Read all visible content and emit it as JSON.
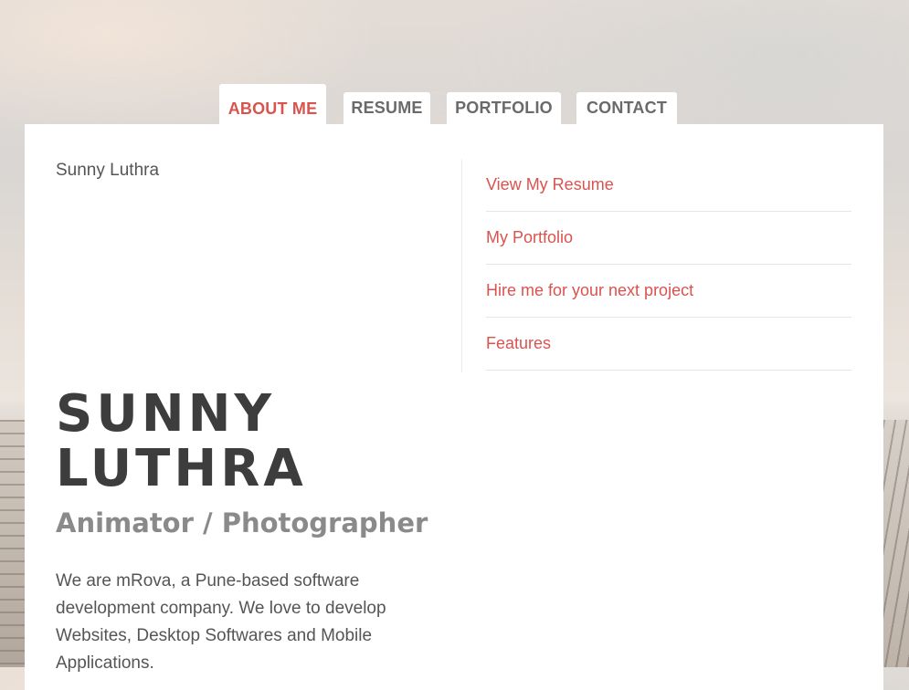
{
  "tabs": [
    {
      "label": "ABOUT ME",
      "active": true
    },
    {
      "label": "RESUME",
      "active": false
    },
    {
      "label": "PORTFOLIO",
      "active": false
    },
    {
      "label": "CONTACT",
      "active": false
    }
  ],
  "profile": {
    "name_small": "Sunny Luthra",
    "hero_line1": "SUNNY",
    "hero_line2": "LUTHRA",
    "title": "Animator / Photographer",
    "bio": "We are mRova, a Pune-based software development company. We love to develop Websites, Desktop Softwares and Mobile Applications."
  },
  "links": [
    {
      "label": "View My Resume"
    },
    {
      "label": "My Portfolio"
    },
    {
      "label": "Hire me for your next project"
    },
    {
      "label": "Features"
    }
  ],
  "colors": {
    "accent": "#d9534f",
    "text": "#555555",
    "heading": "#3d3d3d",
    "subheading": "#8a8a8a",
    "panel": "#ffffff"
  }
}
